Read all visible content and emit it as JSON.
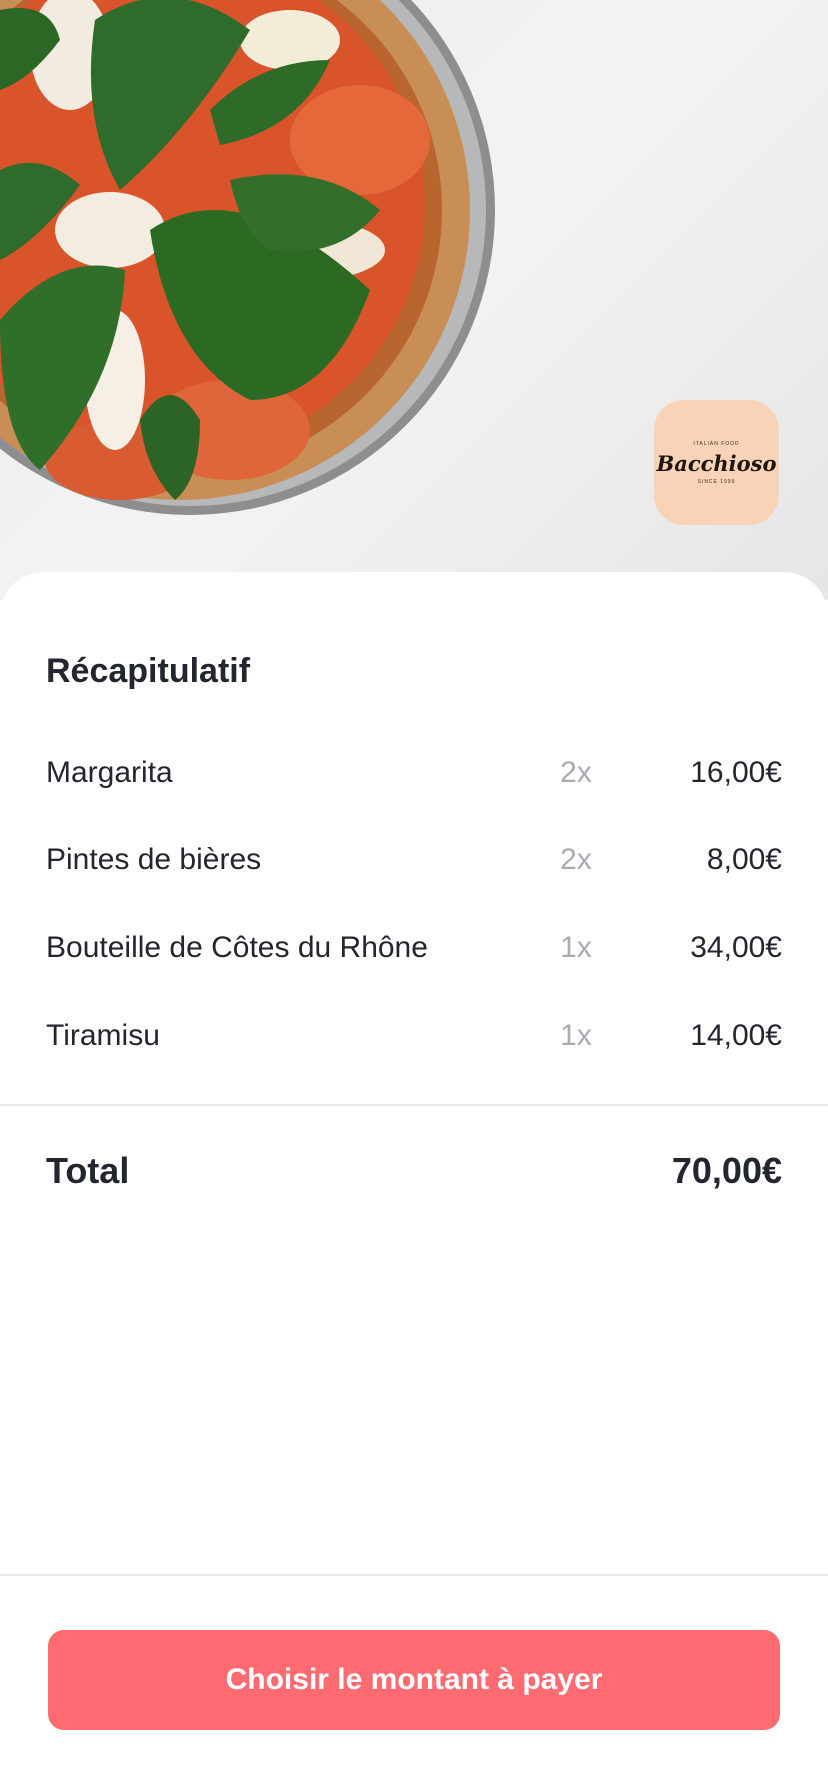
{
  "restaurant": {
    "logo_top": "ITALIAN FOOD",
    "logo_name": "Bacchioso",
    "logo_bottom": "SINCE 1999"
  },
  "summary": {
    "title": "Récapitulatif",
    "items": [
      {
        "name": "Margarita",
        "qty": "2x",
        "price": "16,00€"
      },
      {
        "name": "Pintes de bières",
        "qty": "2x",
        "price": "8,00€"
      },
      {
        "name": "Bouteille de Côtes du Rhône",
        "qty": "1x",
        "price": "34,00€"
      },
      {
        "name": "Tiramisu",
        "qty": "1x",
        "price": "14,00€"
      }
    ],
    "total_label": "Total",
    "total_value": "70,00€"
  },
  "actions": {
    "pay_label": "Choisir le montant à payer"
  },
  "colors": {
    "accent": "#ff6b70",
    "logo_bg": "#f8d3b8",
    "text": "#23262f",
    "muted": "#a9abb3"
  }
}
